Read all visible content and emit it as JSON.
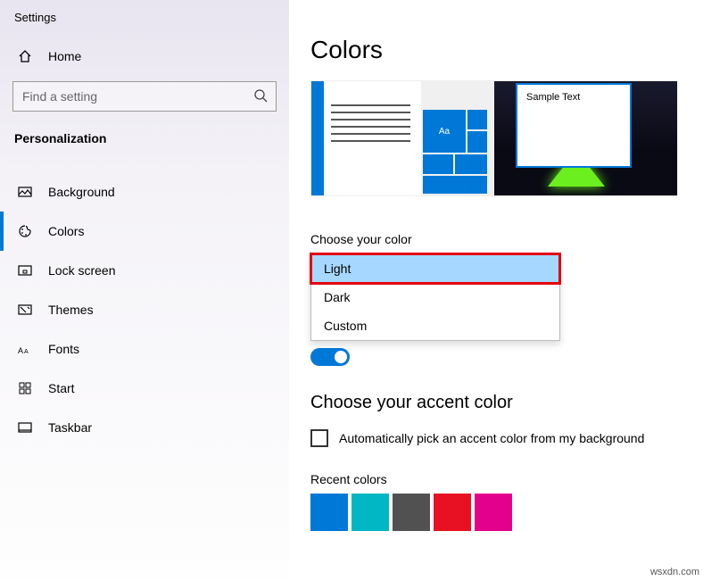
{
  "app_title": "Settings",
  "home_label": "Home",
  "search": {
    "placeholder": "Find a setting"
  },
  "category": "Personalization",
  "nav": [
    {
      "label": "Background"
    },
    {
      "label": "Colors"
    },
    {
      "label": "Lock screen"
    },
    {
      "label": "Themes"
    },
    {
      "label": "Fonts"
    },
    {
      "label": "Start"
    },
    {
      "label": "Taskbar"
    }
  ],
  "main": {
    "heading": "Colors",
    "preview": {
      "tile_text": "Aa",
      "sample_text": "Sample Text"
    },
    "choose_color_label": "Choose your color",
    "color_options": {
      "light": "Light",
      "dark": "Dark",
      "custom": "Custom"
    },
    "accent_heading": "Choose your accent color",
    "auto_pick_label": "Automatically pick an accent color from my background",
    "recent_label": "Recent colors",
    "recent_colors": [
      "#0078d7",
      "#00b7c3",
      "#515151",
      "#e81123",
      "#e3008c"
    ]
  },
  "attribution": "wsxdn.com"
}
